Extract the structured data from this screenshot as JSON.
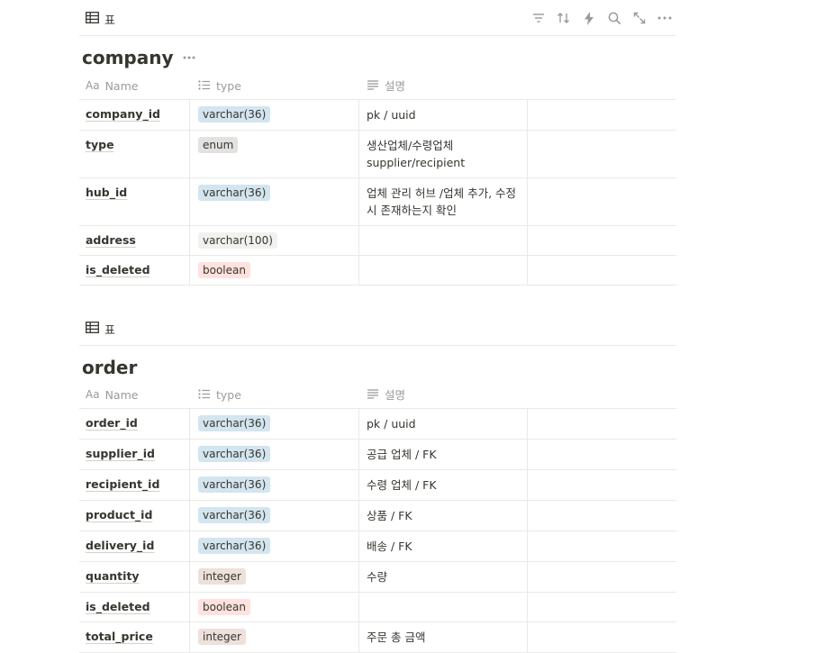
{
  "view_label": "표",
  "table1": {
    "title": "company",
    "columns": [
      "Name",
      "type",
      "설명"
    ],
    "rows": [
      {
        "name": "company_id",
        "type": "varchar(36)",
        "color": "blue",
        "desc": "pk / uuid"
      },
      {
        "name": "type",
        "type": "enum",
        "color": "gray",
        "desc": "생산업체/수령업체 supplier/recipient"
      },
      {
        "name": "hub_id",
        "type": "varchar(36)",
        "color": "blue",
        "desc": "업체 관리 허브 /업체 추가, 수정 시 존재하는지 확인"
      },
      {
        "name": "address",
        "type": "varchar(100)",
        "color": "plain",
        "desc": ""
      },
      {
        "name": "is_deleted",
        "type": "boolean",
        "color": "red",
        "desc": ""
      }
    ]
  },
  "table2": {
    "title": "order",
    "columns": [
      "Name",
      "type",
      "설명"
    ],
    "rows": [
      {
        "name": "order_id",
        "type": "varchar(36)",
        "color": "blue",
        "desc": "pk / uuid"
      },
      {
        "name": "supplier_id",
        "type": "varchar(36)",
        "color": "blue",
        "desc": "공급 업체 / FK"
      },
      {
        "name": "recipient_id",
        "type": "varchar(36)",
        "color": "blue",
        "desc": "수령 업체 / FK"
      },
      {
        "name": "product_id",
        "type": "varchar(36)",
        "color": "blue",
        "desc": "상품 / FK"
      },
      {
        "name": "delivery_id",
        "type": "varchar(36)",
        "color": "blue",
        "desc": "배송 / FK"
      },
      {
        "name": "quantity",
        "type": "integer",
        "color": "brown",
        "desc": "수량"
      },
      {
        "name": "is_deleted",
        "type": "boolean",
        "color": "red",
        "desc": ""
      },
      {
        "name": "total_price",
        "type": "integer",
        "color": "brown",
        "desc": "주문 총 금액"
      }
    ]
  },
  "colors": {
    "blue": "#d3e5ef",
    "gray": "#e3e2e0",
    "plain": "#f1f1ef",
    "red": "#ffe2dd",
    "brown": "#eee0da"
  },
  "icons": {
    "toolbar": [
      "filter-icon",
      "sort-icon",
      "lightning-icon",
      "search-icon",
      "expand-icon",
      "more-icon"
    ]
  }
}
